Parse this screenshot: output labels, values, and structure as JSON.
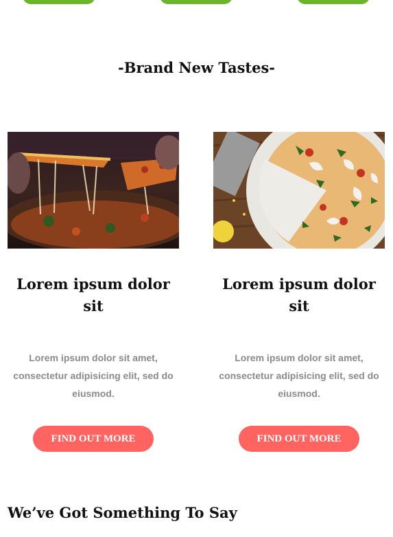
{
  "section_title": "-Brand New Tastes-",
  "cards": [
    {
      "title": "Lorem ipsum dolor sit",
      "text": "Lorem ipsum dolor sit amet, consectetur adipisicing elit, sed do eiusmod.",
      "button_label": "FIND OUT MORE"
    },
    {
      "title": "Lorem ipsum dolor sit",
      "text": "Lorem ipsum dolor sit amet, consectetur adipisicing elit, sed do eiusmod.",
      "button_label": "FIND OUT MORE"
    }
  ],
  "bottom_title": "We’ve Got Something To Say",
  "colors": {
    "top_button": "#6ab52a",
    "cta_button": "#ff6461",
    "body_text": "#8a8a8a",
    "heading": "#111111"
  }
}
